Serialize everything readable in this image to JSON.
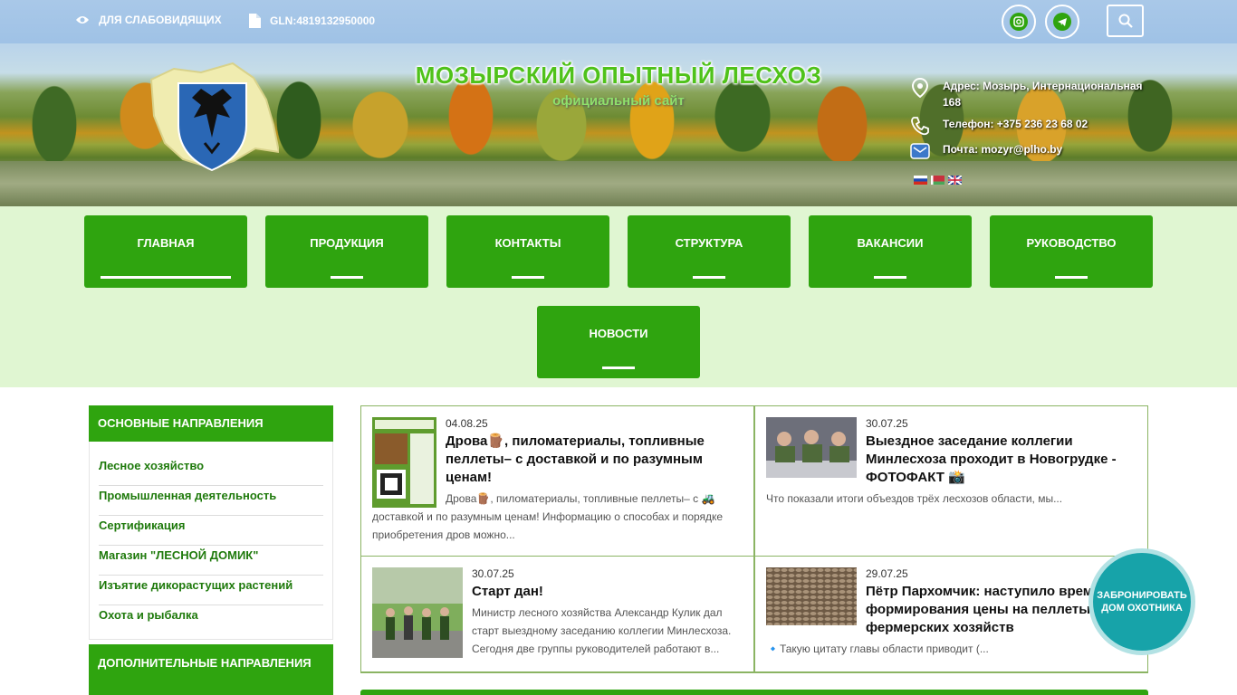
{
  "topbar": {
    "accessibility_label": "ДЛЯ СЛАБОВИДЯЩИХ",
    "gln_label": "GLN:4819132950000"
  },
  "header": {
    "title": "МОЗЫРСКИЙ ОПЫТНЫЙ ЛЕСХОЗ",
    "subtitle": "официальный сайт",
    "address": "Адрес: Мозырь, Интернациональная 168",
    "phone": "Телефон: +375 236 23 68 02",
    "email": "Почта: mozyr@plho.by"
  },
  "nav": {
    "items": [
      "ГЛАВНАЯ",
      "ПРОДУКЦИЯ",
      "КОНТАКТЫ",
      "СТРУКТУРА",
      "ВАКАНСИИ",
      "РУКОВОДСТВО",
      "НОВОСТИ"
    ]
  },
  "sidebar": {
    "main_heading": "ОСНОВНЫЕ НАПРАВЛЕНИЯ",
    "items": [
      "Лесное хозяйство",
      "Промышленная деятельность",
      "Сертификация",
      "Магазин \"ЛЕСНОЙ ДОМИК\"",
      "Изъятие дикорастущих растений",
      "Охота и рыбалка"
    ],
    "extra_heading": "ДОПОЛНИТЕЛЬНЫЕ НАПРАВЛЕНИЯ"
  },
  "news": [
    {
      "date": "04.08.25",
      "title": "Дрова🪵, пиломатериалы, топливные пеллеты– с доставкой и по разумным ценам!",
      "text": "Дрова🪵, пиломатериалы, топливные пеллеты– с 🚜 доставкой и по разумным ценам! Информацию о способах и порядке приобретения дров можно..."
    },
    {
      "date": "30.07.25",
      "title": "Выездное заседание коллегии Минлесхоза проходит в Новогрудке - ФОТОФАКТ 📸",
      "text": "Что показали итоги объездов трёх лесхозов области, мы..."
    },
    {
      "date": "30.07.25",
      "title": "Старт дан!",
      "text": "Министр лесного хозяйства Александр Кулик дал старт выездному заседанию коллегии Минлесхоза. Сегодня две группы руководителей работают в..."
    },
    {
      "date": "29.07.25",
      "title": "Пётр Пархомчик: наступило время формирования цены на пеллеты для фермерских хозяйств",
      "text": "🔹Такую цитату главы области приводит (..."
    }
  ],
  "booking": {
    "label": "ЗАБРОНИРОВАТЬ ДОМ ОХОТНИКА"
  },
  "colors": {
    "brand_green": "#2fa40f",
    "nav_bg": "#e0f6d2",
    "topbar": "#a9c8e8",
    "booking": "#17a3a9"
  }
}
